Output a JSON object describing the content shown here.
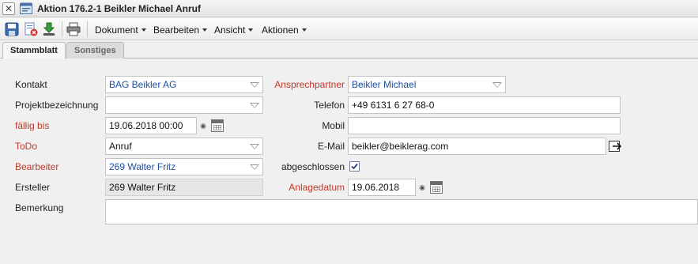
{
  "window": {
    "title": "Aktion 176.2-1 Beikler Michael Anruf",
    "close_label": "✕"
  },
  "toolbar": {
    "menus": [
      "Dokument",
      "Bearbeiten",
      "Ansicht",
      "Aktionen"
    ],
    "icons": [
      "save-icon",
      "delete-icon",
      "download-icon",
      "print-icon"
    ]
  },
  "tabs": [
    "Stammblatt",
    "Sonstiges"
  ],
  "form": {
    "kontakt": {
      "label": "Kontakt",
      "value": "BAG Beikler AG"
    },
    "projektbezeichnung": {
      "label": "Projektbezeichnung",
      "value": ""
    },
    "faellig_bis": {
      "label": "fällig bis",
      "value": "19.06.2018 00:00"
    },
    "todo": {
      "label": "ToDo",
      "value": "Anruf"
    },
    "bearbeiter": {
      "label": "Bearbeiter",
      "value": "269 Walter Fritz"
    },
    "ersteller": {
      "label": "Ersteller",
      "value": "269 Walter Fritz"
    },
    "bemerkung": {
      "label": "Bemerkung",
      "value": ""
    },
    "ansprechpartner": {
      "label": "Ansprechpartner",
      "value": "Beikler Michael"
    },
    "telefon": {
      "label": "Telefon",
      "value": "+49 6131 6 27 68-0"
    },
    "mobil": {
      "label": "Mobil",
      "value": ""
    },
    "email": {
      "label": "E-Mail",
      "value": "beikler@beiklerag.com"
    },
    "abgeschlossen": {
      "label": "abgeschlossen",
      "checked": true
    },
    "anlagedatum": {
      "label": "Anlagedatum",
      "value": "19.06.2018"
    }
  },
  "colors": {
    "required_label": "#c0392b",
    "link_value": "#1c4ea0"
  }
}
